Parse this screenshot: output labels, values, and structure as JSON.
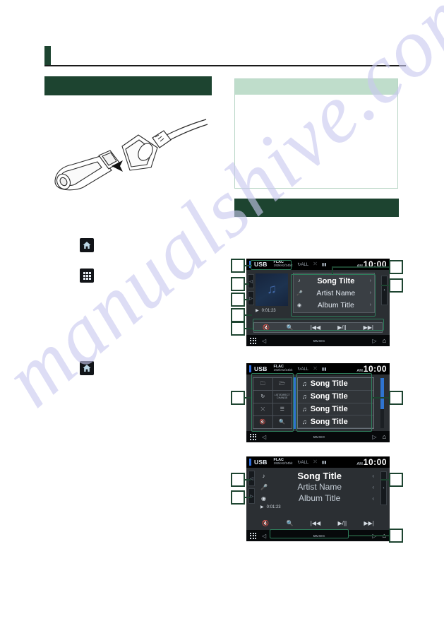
{
  "document": {
    "header_title": "",
    "section_left_title": "",
    "section_right_title": "",
    "note": {
      "heading": "",
      "body": ""
    },
    "watermark": "manualshive.com"
  },
  "left_column": {
    "illustration_name": "usb-device-connection",
    "icon_captions": [
      "",
      "",
      ""
    ],
    "icons": [
      "home-icon",
      "apps-grid-icon",
      "home-icon"
    ]
  },
  "device_screens": [
    {
      "id": "screen-playback",
      "status": {
        "source": "USB",
        "codec": "FLAC",
        "codec_detail": "192kHz/24bit",
        "ampm": "AM",
        "time": "10:00"
      },
      "album_art_icon": "music-note-icon",
      "play_state_icon": "play-icon",
      "elapsed_time": "0:01:23",
      "info_rows": [
        {
          "icon": "music-note-icon",
          "text": "Song Tilte"
        },
        {
          "icon": "microphone-icon",
          "text": "Artist Name"
        },
        {
          "icon": "disc-icon",
          "text": "Album Title"
        }
      ],
      "controls": [
        "mute-icon",
        "search-icon",
        "previous-track-icon",
        "play-pause-icon",
        "next-track-icon"
      ],
      "side_tabs": [
        "left-expand-icon",
        "right-expand-icon"
      ],
      "right_tab": "left-expand-icon",
      "navbar": {
        "grid": "apps-grid-icon",
        "left_arrow": "◁",
        "label": "MUSIC",
        "right_arrow": "▷",
        "home": "home-icon"
      }
    },
    {
      "id": "screen-list",
      "status": {
        "source": "USB",
        "codec": "FLAC",
        "codec_detail": "192kHz/24bit",
        "ampm": "AM",
        "time": "10:00"
      },
      "control_cells": [
        "folder-up-icon",
        "folder-icon",
        "repeat-icon",
        "LIST/DIRECT\\nCHANGE",
        "random-icon",
        "list-icon",
        "mute-icon",
        "search-icon"
      ],
      "list_items": [
        {
          "icon": "music-note-icon",
          "text": "Song Title"
        },
        {
          "icon": "music-note-icon",
          "text": "Song Title"
        },
        {
          "icon": "music-note-icon",
          "text": "Song Title"
        },
        {
          "icon": "music-note-icon",
          "text": "Song Title"
        }
      ],
      "navbar": {
        "grid": "apps-grid-icon",
        "left_arrow": "◁",
        "label": "MUSIC",
        "right_arrow": "▷",
        "home": "home-icon"
      }
    },
    {
      "id": "screen-playback-alt",
      "status": {
        "source": "USB",
        "codec": "FLAC",
        "codec_detail": "192kHz/24bit",
        "ampm": "AM",
        "time": "10:00"
      },
      "elapsed_time": "0:01:23",
      "info_rows": [
        {
          "icon": "music-note-icon",
          "text": "Song Title"
        },
        {
          "icon": "microphone-icon",
          "text": "Artist Name"
        },
        {
          "icon": "disc-icon",
          "text": "Album Title"
        }
      ],
      "controls": [
        "mute-icon",
        "search-icon",
        "previous-track-icon",
        "play-pause-icon",
        "next-track-icon"
      ],
      "navbar": {
        "grid": "apps-grid-icon",
        "left_arrow": "◁",
        "label": "MUSIC",
        "right_arrow": "▷",
        "home": "home-icon"
      }
    }
  ],
  "callouts": {
    "screen1_left": [
      "",
      "",
      "",
      "",
      ""
    ],
    "screen1_right": [
      "",
      ""
    ],
    "screen2_left": [
      ""
    ],
    "screen2_right": [
      ""
    ],
    "screen3_left": [
      "",
      ""
    ],
    "screen3_right": [
      "",
      ""
    ]
  },
  "colors": {
    "dark_green": "#1d4430",
    "light_green": "#bfddcb",
    "accent_blue": "#2f74d0",
    "highlight": "#2e7d5b"
  }
}
